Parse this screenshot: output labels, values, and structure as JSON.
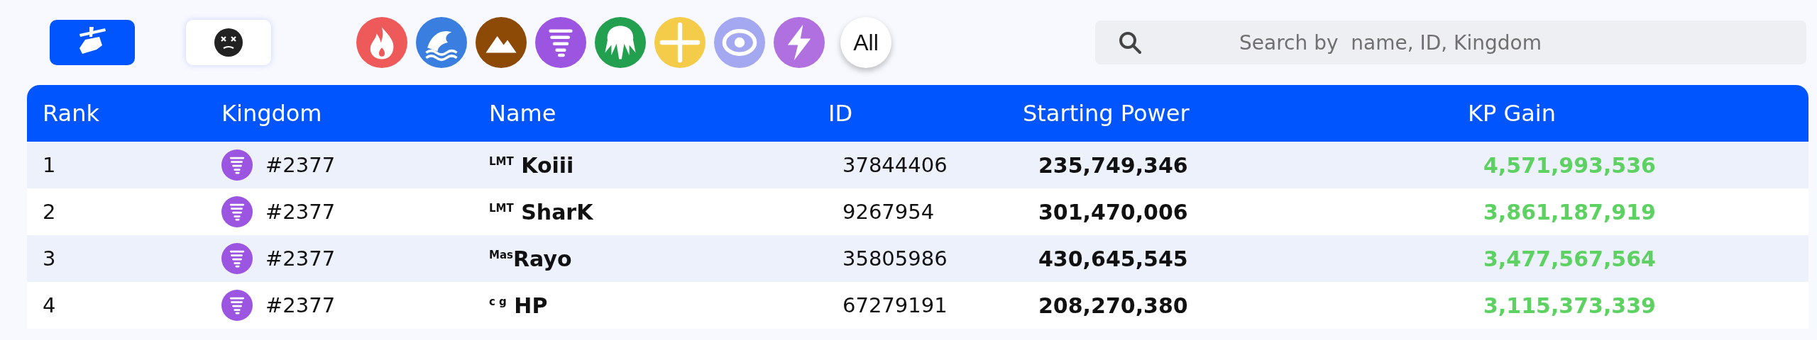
{
  "mode_toggles": [
    {
      "kind": "hammer",
      "selected": true
    },
    {
      "kind": "face",
      "selected": false
    }
  ],
  "element_filters": [
    {
      "kind": "fire",
      "color": "#ee5a5a",
      "selected": false
    },
    {
      "kind": "water",
      "color": "#3a7fe0",
      "selected": false
    },
    {
      "kind": "earth",
      "color": "#8c4a06",
      "selected": false
    },
    {
      "kind": "wind",
      "color": "#9c55e0",
      "selected": false
    },
    {
      "kind": "tree",
      "color": "#22a050",
      "selected": false
    },
    {
      "kind": "light",
      "color": "#f5cc4a",
      "selected": false
    },
    {
      "kind": "void",
      "color": "#a4a8f0",
      "selected": false
    },
    {
      "kind": "lightning",
      "color": "#b070e0",
      "selected": false
    }
  ],
  "all_filter": {
    "label": "All",
    "selected": true
  },
  "search": {
    "placeholder": "Search by  name, ID, Kingdom"
  },
  "table": {
    "columns": [
      "Rank",
      "Kingdom",
      "Name",
      "ID",
      "Starting Power",
      "KP Gain"
    ],
    "rows": [
      {
        "rank": "1",
        "kingdom": {
          "kind": "wind",
          "label": "#2377"
        },
        "name": "$^{LMT}$ Koiii",
        "id": "37844406",
        "starting_power": "235,749,346",
        "kp_gain": "4,571,993,536"
      },
      {
        "rank": "2",
        "kingdom": {
          "kind": "wind",
          "label": "#2377"
        },
        "name": "$^{LMT}$ SharK",
        "id": "9267954",
        "starting_power": "301,470,006",
        "kp_gain": "3,861,187,919"
      },
      {
        "rank": "3",
        "kingdom": {
          "kind": "wind",
          "label": "#2377"
        },
        "name": "$^{Mas}$Rayo",
        "id": "35805986",
        "starting_power": "430,645,545",
        "kp_gain": "3,477,567,564"
      },
      {
        "rank": "4",
        "kingdom": {
          "kind": "wind",
          "label": "#2377"
        },
        "name": "$^{c g}$ HP",
        "id": "67279191",
        "starting_power": "208,270,380",
        "kp_gain": "3,115,373,339"
      }
    ]
  }
}
